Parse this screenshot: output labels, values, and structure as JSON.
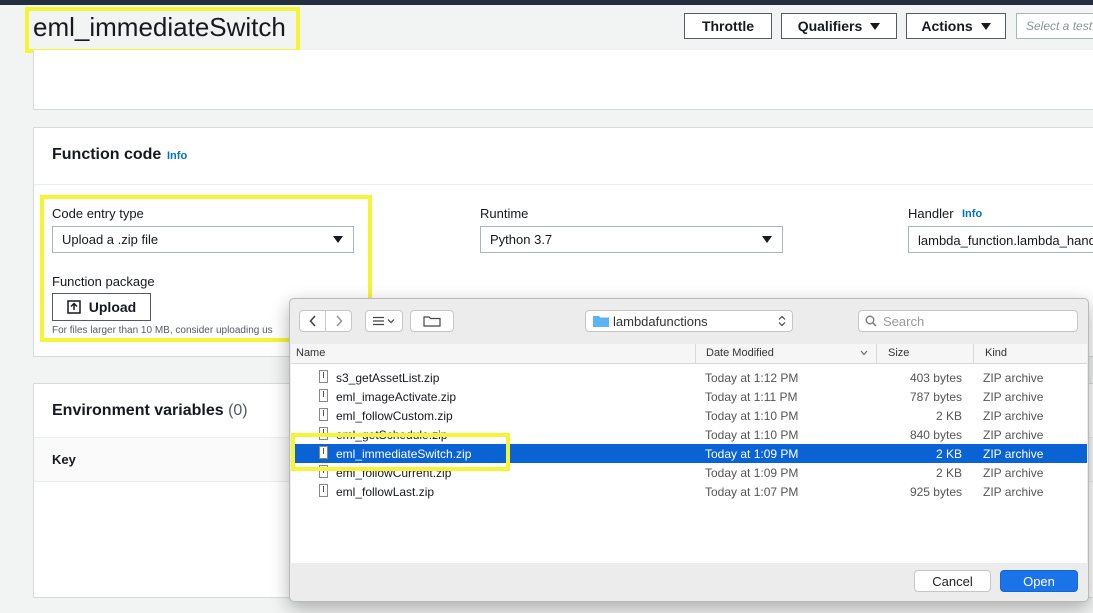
{
  "function_name": "eml_immediateSwitch",
  "header_buttons": {
    "throttle": "Throttle",
    "qualifiers": "Qualifiers",
    "actions": "Actions",
    "test_placeholder": "Select a test"
  },
  "function_code": {
    "heading": "Function code",
    "info": "Info",
    "code_entry_label": "Code entry type",
    "code_entry_value": "Upload a .zip file",
    "runtime_label": "Runtime",
    "runtime_value": "Python 3.7",
    "handler_label": "Handler",
    "handler_info": "Info",
    "handler_value": "lambda_function.lambda_hand",
    "package_label": "Function package",
    "upload_label": "Upload",
    "upload_hint": "For files larger than 10 MB, consider uploading us"
  },
  "env_vars": {
    "heading": "Environment variables",
    "count": "(0)",
    "key_header": "Key"
  },
  "file_dialog": {
    "folder": "lambdafunctions",
    "search_placeholder": "Search",
    "columns": {
      "name": "Name",
      "date": "Date Modified",
      "size": "Size",
      "kind": "Kind"
    },
    "files": [
      {
        "name": "s3_getAssetList.zip",
        "date": "Today at 1:12 PM",
        "size": "403 bytes",
        "kind": "ZIP archive"
      },
      {
        "name": "eml_imageActivate.zip",
        "date": "Today at 1:11 PM",
        "size": "787 bytes",
        "kind": "ZIP archive"
      },
      {
        "name": "eml_followCustom.zip",
        "date": "Today at 1:10 PM",
        "size": "2 KB",
        "kind": "ZIP archive"
      },
      {
        "name": "eml_getSchedule.zip",
        "date": "Today at 1:10 PM",
        "size": "840 bytes",
        "kind": "ZIP archive"
      },
      {
        "name": "eml_immediateSwitch.zip",
        "date": "Today at 1:09 PM",
        "size": "2 KB",
        "kind": "ZIP archive",
        "selected": true
      },
      {
        "name": "eml_followCurrent.zip",
        "date": "Today at 1:09 PM",
        "size": "2 KB",
        "kind": "ZIP archive"
      },
      {
        "name": "eml_followLast.zip",
        "date": "Today at 1:07 PM",
        "size": "925 bytes",
        "kind": "ZIP archive"
      }
    ],
    "cancel_label": "Cancel",
    "open_label": "Open"
  },
  "colors": {
    "highlight": "#f5f535",
    "selection": "#0a63d4",
    "aws_link": "#0073bb",
    "primary_button": "#1a73e8"
  }
}
